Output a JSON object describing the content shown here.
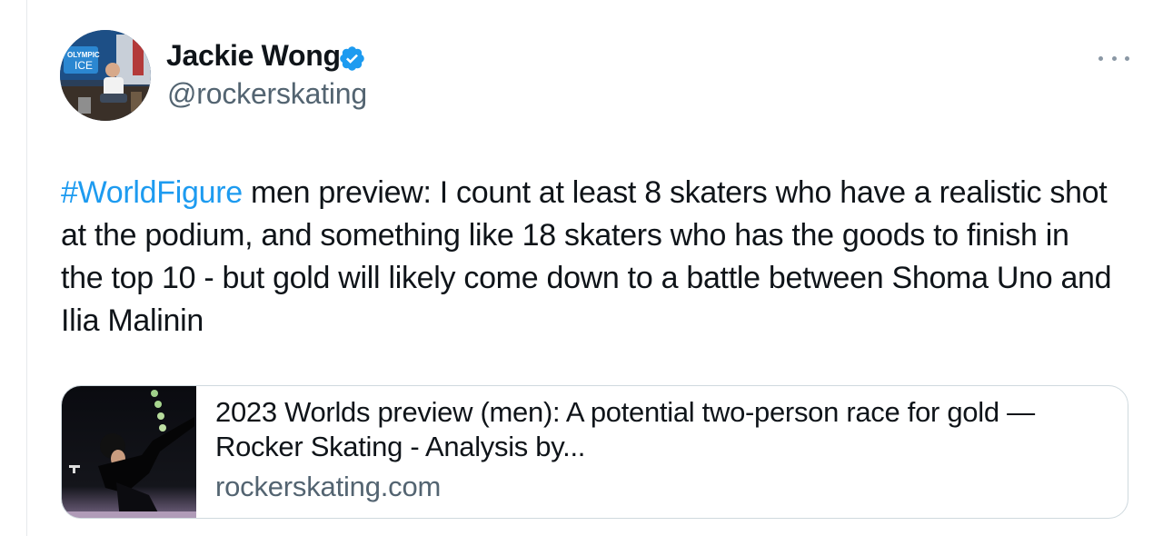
{
  "author": {
    "name": "Jackie Wong",
    "handle": "@rockerskating",
    "verified": true,
    "avatar_logo_text": [
      "OLYMPIC",
      "ICE"
    ]
  },
  "tweet": {
    "hashtag": "#WorldFigure",
    "text": " men preview: I count at least 8 skaters who have a realistic shot at the podium, and something like 18 skaters who has the goods to finish in the top 10 - but gold will likely come down to a battle between Shoma Uno and Ilia Malinin"
  },
  "link_card": {
    "title": "2023 Worlds preview (men): A potential two-person race for gold — Rocker Skating - Analysis by...",
    "domain": "rockerskating.com"
  },
  "colors": {
    "accent": "#1d9bf0",
    "text": "#0f1419",
    "secondary_text": "#536471",
    "border": "#cfd9de"
  },
  "icons": {
    "verified": "verified-badge-icon",
    "more": "more-horizontal-icon"
  }
}
